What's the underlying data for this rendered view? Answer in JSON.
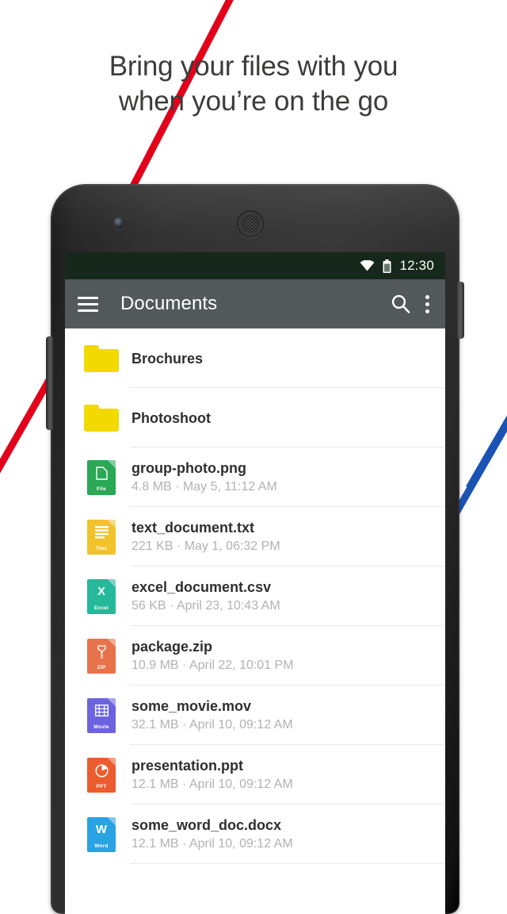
{
  "headline": {
    "line1": "Bring your files with you",
    "line2": "when you’re on the go",
    "color": "#3c3c3b"
  },
  "decor": {
    "red_line_color": "#e2001a",
    "blue_line_color": "#1b53b4"
  },
  "device": {
    "frame_color": "#2e2e2e",
    "camera_label": "front-camera",
    "speaker_label": "earpiece-speaker"
  },
  "statusbar": {
    "time": "12:30",
    "wifi_icon": "wifi-icon",
    "battery_icon": "battery-icon",
    "background": "#16271b"
  },
  "appbar": {
    "title": "Documents",
    "menu_icon": "hamburger-menu-icon",
    "search_icon": "search-icon",
    "overflow_icon": "overflow-menu-icon",
    "background": "#53585a"
  },
  "files": [
    {
      "name": "Brochures",
      "meta": "",
      "kind": "folder",
      "icon_color": "#f2d900",
      "icon_tag": "",
      "icon_glyph": ""
    },
    {
      "name": "Photoshoot",
      "meta": "",
      "kind": "folder",
      "icon_color": "#f2d900",
      "icon_tag": "",
      "icon_glyph": ""
    },
    {
      "name": "group-photo.png",
      "meta": "4.8 MB · May 5, 11:12 AM",
      "kind": "file",
      "icon_color": "#2aa855",
      "icon_tag": "File",
      "icon_glyph": "doc"
    },
    {
      "name": "text_document.txt",
      "meta": "221 KB · May 1, 06:32 PM",
      "kind": "file",
      "icon_color": "#f2c22b",
      "icon_tag": "Text",
      "icon_glyph": "lines"
    },
    {
      "name": "excel_document.csv",
      "meta": "56 KB · April 23, 10:43 AM",
      "kind": "file",
      "icon_color": "#25b99a",
      "icon_tag": "Excel",
      "icon_glyph": "X"
    },
    {
      "name": "package.zip",
      "meta": "10.9 MB · April 22, 10:01 PM",
      "kind": "file",
      "icon_color": "#e8724a",
      "icon_tag": "ZIP",
      "icon_glyph": "zip"
    },
    {
      "name": "some_movie.mov",
      "meta": "32.1 MB · April 10, 09:12 AM",
      "kind": "file",
      "icon_color": "#6b63e0",
      "icon_tag": "Movie",
      "icon_glyph": "film"
    },
    {
      "name": "presentation.ppt",
      "meta": "12.1 MB · April 10, 09:12 AM",
      "kind": "file",
      "icon_color": "#ec5c2e",
      "icon_tag": "PPT",
      "icon_glyph": "pie"
    },
    {
      "name": "some_word_doc.docx",
      "meta": "12.1 MB · April 10, 09:12 AM",
      "kind": "file",
      "icon_color": "#29a3e3",
      "icon_tag": "Word",
      "icon_glyph": "W"
    }
  ]
}
